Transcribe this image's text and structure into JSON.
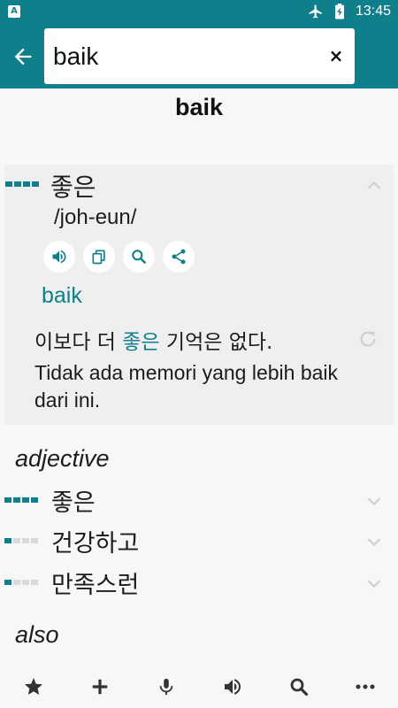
{
  "status_bar": {
    "app_badge": "A",
    "time": "13:45"
  },
  "search": {
    "value": "baik"
  },
  "headword": "baik",
  "primary": {
    "term": "좋은",
    "romanization": "/joh-eun/",
    "translation": "baik",
    "example_ko_before": "이보다 더 ",
    "example_ko_highlight": "좋은",
    "example_ko_after": " 기억은 없다.",
    "example_id": "Tidak ada memori yang lebih baik dari ini.",
    "frequency": 4
  },
  "sections": [
    {
      "label": "adjective",
      "items": [
        {
          "term": "좋은",
          "frequency": 4
        },
        {
          "term": "건강하고",
          "frequency": 1
        },
        {
          "term": "만족스런",
          "frequency": 1
        }
      ]
    },
    {
      "label": "also"
    }
  ],
  "accent_color": "#0f7f8c",
  "icons": {
    "back": "arrow-left-icon",
    "clear": "close-icon",
    "actions": [
      "speaker-icon",
      "copy-icon",
      "search-icon",
      "share-icon"
    ],
    "bottom": [
      "star-icon",
      "plus-icon",
      "microphone-icon",
      "speaker-icon",
      "search-icon",
      "more-icon"
    ]
  }
}
